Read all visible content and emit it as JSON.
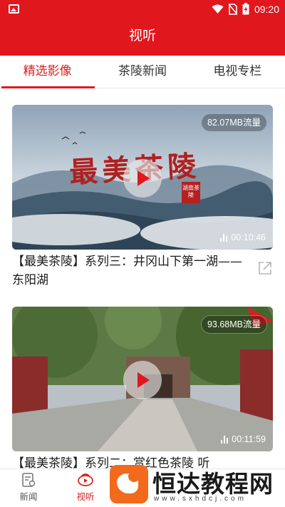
{
  "status_bar": {
    "time": "09:20",
    "icons": [
      "image-icon",
      "wifi-icon",
      "no-sim-icon",
      "battery-charging-icon"
    ]
  },
  "header": {
    "title": "视听"
  },
  "tabs": [
    {
      "label": "精选影像",
      "active": true
    },
    {
      "label": "茶陵新闻",
      "active": false
    },
    {
      "label": "电视专栏",
      "active": false
    }
  ],
  "videos": [
    {
      "size": "82.07MB流量",
      "duration": "00:10:46",
      "title": "【最美茶陵】系列三：井冈山下第一湖——东阳湖",
      "overlay_text": "最美茶陵",
      "seal_text": "湖南茶陵"
    },
    {
      "size": "93.68MB流量",
      "duration": "00:11:59",
      "title": "【最美茶陵】系列二：赏红色茶陵 听"
    }
  ],
  "bottom_nav": [
    {
      "label": "新闻",
      "icon": "news-icon",
      "active": false
    },
    {
      "label": "视听",
      "icon": "video-icon",
      "active": true
    }
  ],
  "watermark": {
    "title": "恒达教程网",
    "url": "www.sxhdcj.com"
  },
  "colors": {
    "brand_red": "#e0171d",
    "tab_active": "#d81e1e",
    "watermark_orange": "#f26a1b"
  }
}
